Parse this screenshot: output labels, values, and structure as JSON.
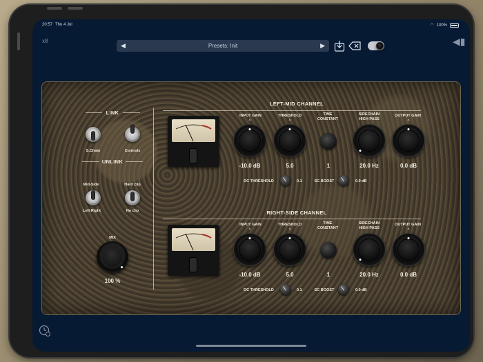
{
  "status_bar": {
    "time": "20:57",
    "date": "Thu 4 Jul",
    "battery": "100%"
  },
  "header": {
    "oversampling": "x8",
    "preset_label": "Presets: Init",
    "prev_icon": "chevron-left-icon",
    "next_icon": "chevron-right-icon",
    "save_icon": "save-icon",
    "clear_icon": "clear-icon",
    "theme_icon": "moon-icon",
    "speaker_icon": "speaker-icon"
  },
  "left": {
    "link_title": "LINK",
    "unlink_title": "UNLINK",
    "schain_label": "S.Chain",
    "controls_label": "Controls",
    "mid_side_label": "Mid-Side",
    "left_right_label": "Left-Right",
    "hard_clip_label": "Hard clip",
    "no_clip_label": "No clip",
    "mix_label": "MIX",
    "mix_value": "100 %"
  },
  "channels": [
    {
      "title": "LEFT-MID CHANNEL",
      "input_gain_label": "INPUT GAIN",
      "input_gain_value": "-10.0 dB",
      "threshold_label": "THRESHOLD",
      "threshold_value": "5.0",
      "time_label": "TIME\nCONSTANT",
      "time_value": "1",
      "sidechain_label": "SIDECHAIN\nHIGH PASS",
      "sidechain_value": "20.0 Hz",
      "output_gain_label": "OUTPUT GAIN",
      "output_gain_value": "0.0 dB",
      "dc_label": "DC THRESHOLD",
      "dc_value": "0.1",
      "sc_boost_label": "SC BOOST",
      "sc_boost_value": "0.0 dB"
    },
    {
      "title": "RIGHT-SIDE CHANNEL",
      "input_gain_label": "INPUT GAIN",
      "input_gain_value": "-10.0 dB",
      "threshold_label": "THRESHOLD",
      "threshold_value": "5.0",
      "time_label": "TIME\nCONSTANT",
      "time_value": "1",
      "sidechain_label": "SIDECHAIN\nHIGH PASS",
      "sidechain_value": "20.0 Hz",
      "output_gain_label": "OUTPUT GAIN",
      "output_gain_value": "0.0 dB",
      "dc_label": "DC THRESHOLD",
      "dc_value": "0.1",
      "sc_boost_label": "SC BOOST",
      "sc_boost_value": "0.0 dB"
    }
  ],
  "bottom": {
    "settings_icon": "timer-settings-icon"
  }
}
